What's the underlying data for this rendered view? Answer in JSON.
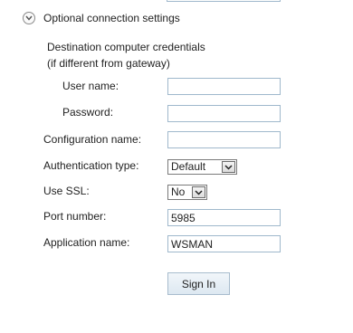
{
  "section": {
    "toggle_label": "Optional connection settings",
    "toggle_icon": "chevron-down-icon"
  },
  "destination": {
    "line1": "Destination computer credentials",
    "line2": "(if different from gateway)",
    "username_label": "User name:",
    "username_value": "",
    "password_label": "Password:",
    "password_value": ""
  },
  "configuration": {
    "label": "Configuration name:",
    "value": ""
  },
  "authentication": {
    "label": "Authentication type:",
    "selected": "Default"
  },
  "ssl": {
    "label": "Use SSL:",
    "selected": "No"
  },
  "port": {
    "label": "Port number:",
    "value": "5985"
  },
  "application": {
    "label": "Application name:",
    "value": "WSMAN"
  },
  "actions": {
    "signin_label": "Sign In"
  },
  "colors": {
    "field_border": "#9fb8cc",
    "button_bg": "#dde8f1"
  }
}
